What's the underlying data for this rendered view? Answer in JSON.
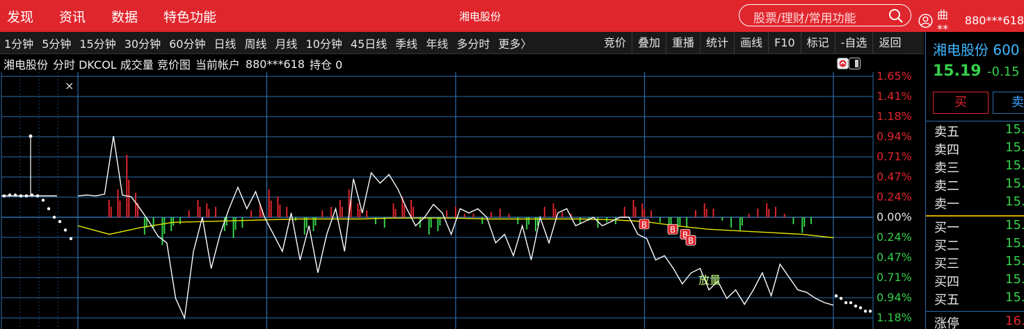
{
  "topnav": {
    "items": [
      "发现",
      "资讯",
      "数据",
      "特色功能"
    ]
  },
  "app_title": "湘电股份",
  "search": {
    "placeholder": "股票/理财/常用功能"
  },
  "user": {
    "name": "曲**",
    "account": "880***618"
  },
  "periods": [
    "1分钟",
    "5分钟",
    "15分钟",
    "30分钟",
    "60分钟",
    "日线",
    "周线",
    "月线",
    "10分钟",
    "45日线",
    "季线",
    "年线",
    "多分时",
    "更多〉"
  ],
  "tools": [
    "竞价",
    "叠加",
    "重播",
    "统计",
    "画线",
    "F10",
    "标记",
    "-自选",
    "返回"
  ],
  "chart_header": {
    "stock": "湘电股份",
    "indicators": "分时 DKCOL 成交量 竞价图",
    "account_label": "当前帐户",
    "account": "880***618",
    "position": "持仓 0"
  },
  "close_glyph": "×",
  "colors": {
    "up": "#e0262d",
    "down": "#35d04a",
    "grid": "#2d6fae",
    "price_line": "#ffffff",
    "avg_line": "#e6e600"
  },
  "markers": {
    "buy": "B",
    "volume_label": "放量"
  },
  "chart_data": {
    "type": "line",
    "y_ticks_above": [
      "1.65%",
      "1.41%",
      "1.18%",
      "0.94%",
      "0.71%",
      "0.47%",
      "0.24%"
    ],
    "y_tick_zero": "0.00%",
    "y_ticks_below": [
      "0.24%",
      "0.47%",
      "0.71%",
      "0.94%",
      "1.18%"
    ],
    "ylim": [
      -1.18,
      1.65
    ],
    "x_sections": 4,
    "price_pct": [
      0.25,
      0.26,
      0.25,
      0.27,
      0.95,
      0.26,
      0.24,
      0.1,
      -0.05,
      -0.22,
      -0.3,
      -0.95,
      -1.18,
      -0.4,
      0.0,
      -0.6,
      -0.2,
      0.1,
      0.35,
      0.1,
      0.3,
      0.0,
      -0.2,
      -0.4,
      0.05,
      -0.5,
      -0.1,
      -0.65,
      -0.2,
      0.1,
      -0.4,
      0.45,
      0.05,
      0.52,
      0.4,
      0.5,
      0.33,
      0.1,
      -0.1,
      0.0,
      0.15,
      0.05,
      -0.2,
      0.1,
      0.05,
      0.1,
      0.0,
      -0.3,
      -0.2,
      -0.45,
      -0.1,
      -0.5,
      0.0,
      -0.3,
      0.05,
      0.1,
      -0.1,
      -0.05,
      0.0,
      -0.1,
      -0.05,
      0.0,
      0.0,
      -0.2,
      -0.25,
      -0.5,
      -0.45,
      -0.6,
      -0.78,
      -0.65,
      -0.6,
      -0.85,
      -0.75,
      -0.95,
      -0.85,
      -1.02,
      -0.85,
      -0.65,
      -0.92,
      -0.55,
      -0.7,
      -0.85,
      -0.88,
      -0.95,
      -1.0,
      -1.03
    ],
    "avg_pct": [
      -0.1,
      -0.2,
      -0.12,
      -0.06,
      -0.05,
      -0.04,
      -0.03,
      -0.02,
      -0.02,
      -0.02,
      -0.01,
      -0.01,
      -0.01,
      -0.02,
      -0.02,
      -0.02,
      -0.02,
      -0.03,
      -0.05,
      -0.1,
      -0.14,
      -0.16,
      -0.18,
      -0.2,
      -0.24
    ],
    "volume_bars": [
      0,
      0,
      0,
      0.5,
      0.8,
      1.8,
      0.7,
      -0.5,
      -0.3,
      -0.8,
      -0.4,
      -0.2,
      0.2,
      0.5,
      0.4,
      0.3,
      -0.4,
      -0.6,
      -0.3,
      0.2,
      0.4,
      0.8,
      0.6,
      0.3,
      -0.1,
      -0.5,
      -0.4,
      0.2,
      0.3,
      0.5,
      0.8,
      0.4,
      0.2,
      -0.2,
      -0.3,
      0.4,
      0.6,
      0.5,
      -0.3,
      -0.5,
      -0.4,
      0.2,
      0.3,
      0.1,
      0.1,
      -0.2,
      0.15,
      0.25,
      0.1,
      -0.2,
      -0.35,
      -0.4,
      0.3,
      0.4,
      0.15,
      0.1,
      -0.2,
      -0.1,
      -0.3,
      -0.15,
      -0.2,
      0.3,
      0.5,
      0.4,
      0.2,
      -0.15,
      -0.5,
      -0.4,
      -0.3,
      0.2,
      0.4,
      0.25,
      -0.1,
      -0.3,
      -0.4,
      0.1,
      0.25,
      0.4,
      0.3,
      0.1,
      -0.2,
      -0.45,
      -0.2,
      0,
      0
    ]
  },
  "right_panel": {
    "name": "湘电股份 600",
    "price": "15.19",
    "change": "-0.15",
    "buy_label": "买",
    "sell_label": "卖",
    "asks": [
      {
        "label": "卖五",
        "value": "15."
      },
      {
        "label": "卖四",
        "value": "15."
      },
      {
        "label": "卖三",
        "value": "15."
      },
      {
        "label": "卖二",
        "value": "15."
      },
      {
        "label": "卖一",
        "value": "15."
      }
    ],
    "bids": [
      {
        "label": "买一",
        "value": "15."
      },
      {
        "label": "买二",
        "value": "15."
      },
      {
        "label": "买三",
        "value": "15."
      },
      {
        "label": "买四",
        "value": "15."
      },
      {
        "label": "买五",
        "value": "15."
      }
    ],
    "limit_up": {
      "label": "涨停",
      "value": "16."
    }
  }
}
